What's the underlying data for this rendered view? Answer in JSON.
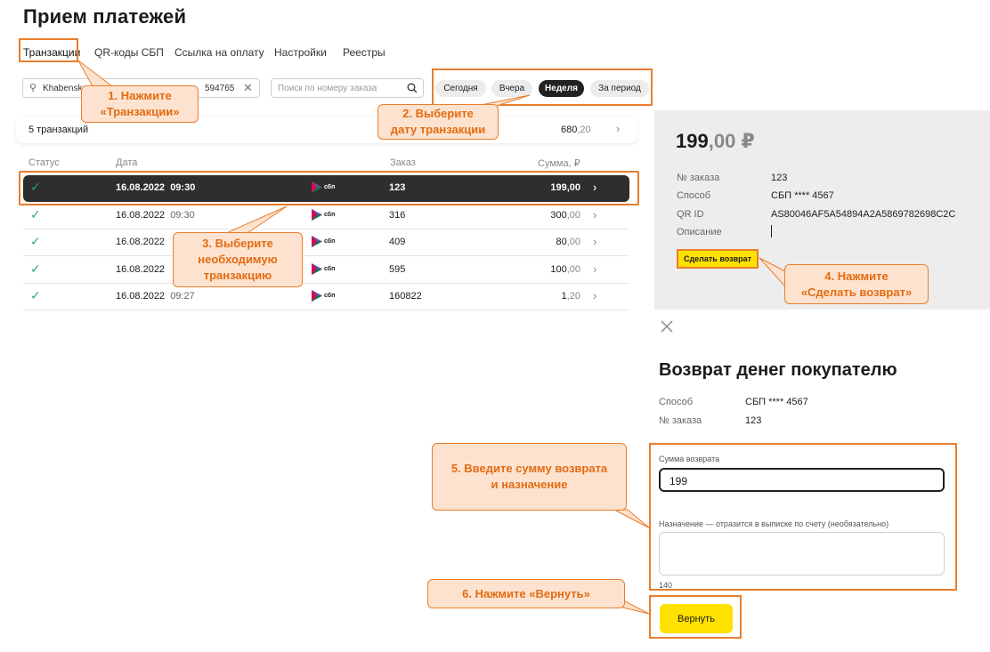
{
  "page": {
    "title": "Прием платежей"
  },
  "tabs": [
    {
      "label": "Транзакции"
    },
    {
      "label": "QR-коды СБП"
    },
    {
      "label": "Ссылка на оплату"
    },
    {
      "label": "Настройки"
    },
    {
      "label": "Реестры"
    }
  ],
  "filters": {
    "merchant_value_left": "Khabensk",
    "merchant_value_right": "594765",
    "order_search_placeholder": "Поиск по номеру заказа",
    "periods": [
      {
        "label": "Сегодня",
        "active": false
      },
      {
        "label": "Вчера",
        "active": false
      },
      {
        "label": "Неделя",
        "active": true
      },
      {
        "label": "За период",
        "active": false
      }
    ]
  },
  "summary": {
    "count_text": "5 транзакций",
    "sum_int": "680",
    "sum_kop": ",20"
  },
  "table": {
    "headers": {
      "status": "Статус",
      "date": "Дата",
      "order": "Заказ",
      "amount": "Сумма, ₽"
    },
    "payment_badge": "сбп",
    "rows": [
      {
        "date": "16.08.2022",
        "time": "09:30",
        "order": "123",
        "amount_int": "199",
        "amount_kop": ",00",
        "selected": true
      },
      {
        "date": "16.08.2022",
        "time": "09:30",
        "order": "316",
        "amount_int": "300",
        "amount_kop": ",00",
        "selected": false
      },
      {
        "date": "16.08.2022",
        "time": "",
        "order": "409",
        "amount_int": "80",
        "amount_kop": ",00",
        "selected": false
      },
      {
        "date": "16.08.2022",
        "time": "",
        "order": "595",
        "amount_int": "100",
        "amount_kop": ",00",
        "selected": false
      },
      {
        "date": "16.08.2022",
        "time": "09:27",
        "order": "160822",
        "amount_int": "1",
        "amount_kop": ",20",
        "selected": false
      }
    ]
  },
  "details": {
    "amount_int": "199",
    "amount_kop": ",00 ₽",
    "fields": [
      {
        "key": "№ заказа",
        "value": "123"
      },
      {
        "key": "Способ",
        "value": "СБП **** 4567"
      },
      {
        "key": "QR ID",
        "value": "AS80046AF5A54894A2A5869782698C2C"
      },
      {
        "key": "Описание",
        "value": ""
      }
    ],
    "refund_button": "Сделать возврат"
  },
  "refund_form": {
    "title": "Возврат денег покупателю",
    "method_key": "Способ",
    "method_value": "СБП **** 4567",
    "order_key": "№ заказа",
    "order_value": "123",
    "amount_label": "Сумма возврата",
    "amount_value": "199",
    "purpose_label": "Назначение — отразится в выписке по счету (необязательно)",
    "char_limit": "140",
    "submit": "Вернуть"
  },
  "callouts": {
    "c1": "1. Нажмите\n«Транзакции»",
    "c2": "2. Выберите\nдату транзакции",
    "c3": "3. Выберите\nнеобходимую\nтранзакцию",
    "c4": "4. Нажмите\n«Сделать возврат»",
    "c5": "5. Введите сумму возврата\nи назначение",
    "c6": "6. Нажмите «Вернуть»"
  },
  "colors": {
    "accent": "#e87e2e",
    "callout_bg": "#fde3cf",
    "button_yellow": "#ffe100",
    "success": "#2aa86a"
  }
}
